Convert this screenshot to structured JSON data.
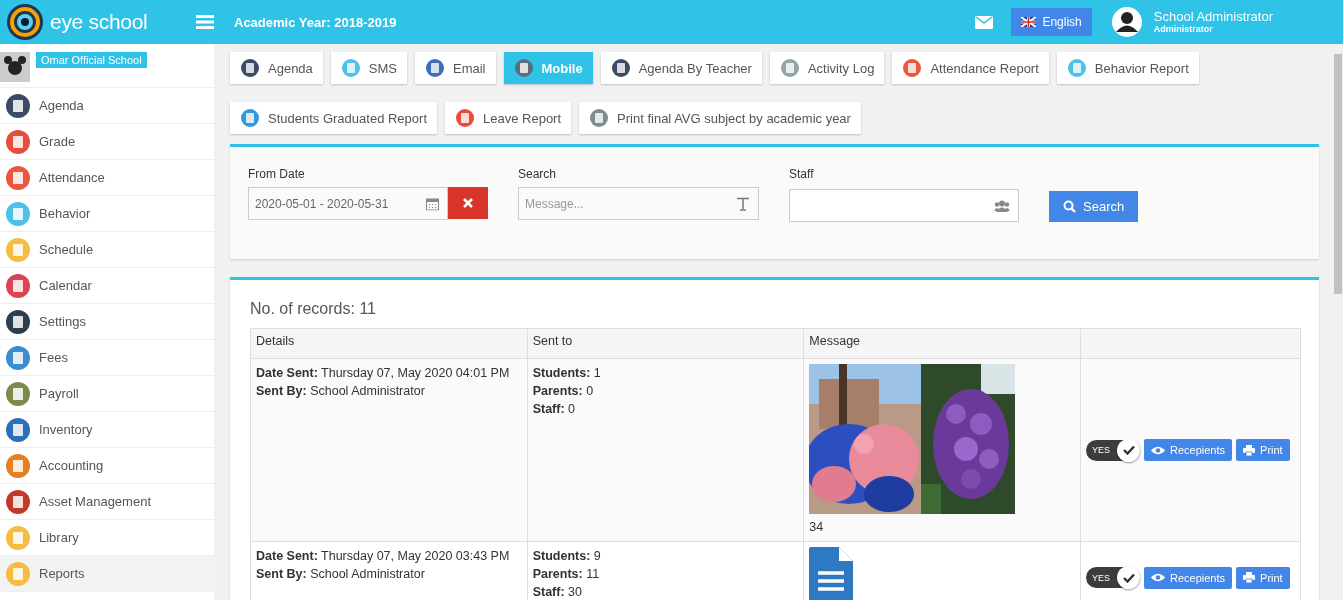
{
  "brand": {
    "name": "eye school"
  },
  "header": {
    "academic_year": "Academic Year: 2018-2019",
    "language": "English",
    "user_name": "School Administrator",
    "user_role": "Administrator"
  },
  "sidebar": {
    "school": "Omar Official School",
    "items": [
      {
        "label": "Agenda",
        "selected": false
      },
      {
        "label": "Grade",
        "selected": false
      },
      {
        "label": "Attendance",
        "selected": false
      },
      {
        "label": "Behavior",
        "selected": false
      },
      {
        "label": "Schedule",
        "selected": false
      },
      {
        "label": "Calendar",
        "selected": false
      },
      {
        "label": "Settings",
        "selected": false
      },
      {
        "label": "Fees",
        "selected": false
      },
      {
        "label": "Payroll",
        "selected": false
      },
      {
        "label": "Inventory",
        "selected": false
      },
      {
        "label": "Accounting",
        "selected": false
      },
      {
        "label": "Asset Management",
        "selected": false
      },
      {
        "label": "Library",
        "selected": false
      },
      {
        "label": "Reports",
        "selected": true
      }
    ]
  },
  "tabs": [
    {
      "label": "Agenda",
      "selected": false
    },
    {
      "label": "SMS",
      "selected": false
    },
    {
      "label": "Email",
      "selected": false
    },
    {
      "label": "Mobile",
      "selected": true
    },
    {
      "label": "Agenda By Teacher",
      "selected": false
    },
    {
      "label": "Activity Log",
      "selected": false
    },
    {
      "label": "Attendance Report",
      "selected": false
    },
    {
      "label": "Behavior Report",
      "selected": false
    },
    {
      "label": "Students Graduated Report",
      "selected": false
    },
    {
      "label": "Leave Report",
      "selected": false
    },
    {
      "label": "Print final AVG subject by academic year",
      "selected": false
    }
  ],
  "filters": {
    "from_date": {
      "label": "From Date",
      "value": "2020-05-01 - 2020-05-31"
    },
    "search": {
      "label": "Search",
      "placeholder": "Message..."
    },
    "staff": {
      "label": "Staff"
    },
    "search_button": "Search"
  },
  "records": {
    "count": "No. of records: 11",
    "columns": [
      "Details",
      "Sent to",
      "Message"
    ],
    "rows": [
      {
        "date_label": "Date Sent:",
        "date": "Thursday 07, May 2020 04:01 PM",
        "by_label": "Sent By:",
        "by": "School Administrator",
        "students_label": "Students:",
        "students": "1",
        "parents_label": "Parents:",
        "parents": "0",
        "staff_label": "Staff:",
        "staff": "0",
        "kind": "photos",
        "message_text": "34",
        "toggle": "YES",
        "toggle_on": true,
        "recipients": "Recepients",
        "print": "Print"
      },
      {
        "date_label": "Date Sent:",
        "date": "Thursday 07, May 2020 03:43 PM",
        "by_label": "Sent By:",
        "by": "School Administrator",
        "students_label": "Students:",
        "students": "9",
        "parents_label": "Parents:",
        "parents": "11",
        "staff_label": "Staff:",
        "staff": "30",
        "kind": "document",
        "toggle": "YES",
        "toggle_on": true,
        "recipients": "Recepients",
        "print": "Print"
      }
    ]
  }
}
